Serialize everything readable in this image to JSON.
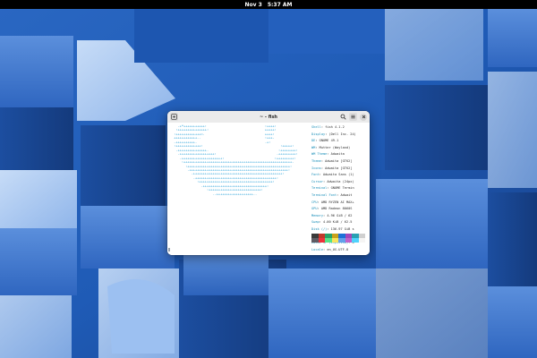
{
  "topbar": {
    "date": "Nov 3",
    "time": "5:37 AM"
  },
  "window": {
    "title": "~ - fish"
  },
  "neofetch": {
    "info": [
      {
        "key": "Shell",
        "value": "fish 4.1.2"
      },
      {
        "key": "Display",
        "value": "(Dell Inc. 24)"
      },
      {
        "key": "DE",
        "value": "GNOME 49.1"
      },
      {
        "key": "WM",
        "value": "Mutter (Wayland)"
      },
      {
        "key": "WM Theme",
        "value": "Adwaita"
      },
      {
        "key": "Theme",
        "value": "Adwaita [GTK2]"
      },
      {
        "key": "Icons",
        "value": "Adwaita [GTK2]"
      },
      {
        "key": "Font",
        "value": "Adwaita Sans (1)"
      },
      {
        "key": "Cursor",
        "value": "Adwaita (24px)"
      },
      {
        "key": "Terminal",
        "value": "GNOME Termin"
      },
      {
        "key": "Terminal Font",
        "value": "Adwait"
      },
      {
        "key": "CPU",
        "value": "AMD RYZEN AI MAX+"
      },
      {
        "key": "GPU",
        "value": "AMD Radeon 8060S"
      },
      {
        "key": "Memory",
        "value": "4.96 GiB / 62"
      },
      {
        "key": "Swap",
        "value": "4.00 KiB / 62.5"
      },
      {
        "key": "Disk (/)",
        "value": "136.97 GiB s"
      },
      {
        "key": "Disk (/run/media/pbor)",
        "value": ""
      },
      {
        "key": "Local IP (enp191s0)",
        "value": "4"
      },
      {
        "key": "Locale",
        "value": "en_US.UTF-8"
      }
    ],
    "palette_top": [
      "#3a3a3a",
      "#c0392b",
      "#26a269",
      "#c8a21c",
      "#1c71d8",
      "#a347ba",
      "#2aa1b3",
      "#d0d0d0"
    ],
    "palette_bottom": [
      "#5e5c64",
      "#ed333b",
      "#57e389",
      "#f8e45c",
      "#62a0ea",
      "#c061cb",
      "#4fd2fd",
      "#f6f5f4"
    ]
  },
  "colors": {
    "logo_primary": "#1a9ad6",
    "logo_secondary": "#1fb5a8",
    "info_key": "#1a8fb9"
  },
  "icons": {
    "new_tab": "new-tab-icon",
    "search": "search-icon",
    "menu": "menu-icon",
    "close": "close-icon"
  }
}
